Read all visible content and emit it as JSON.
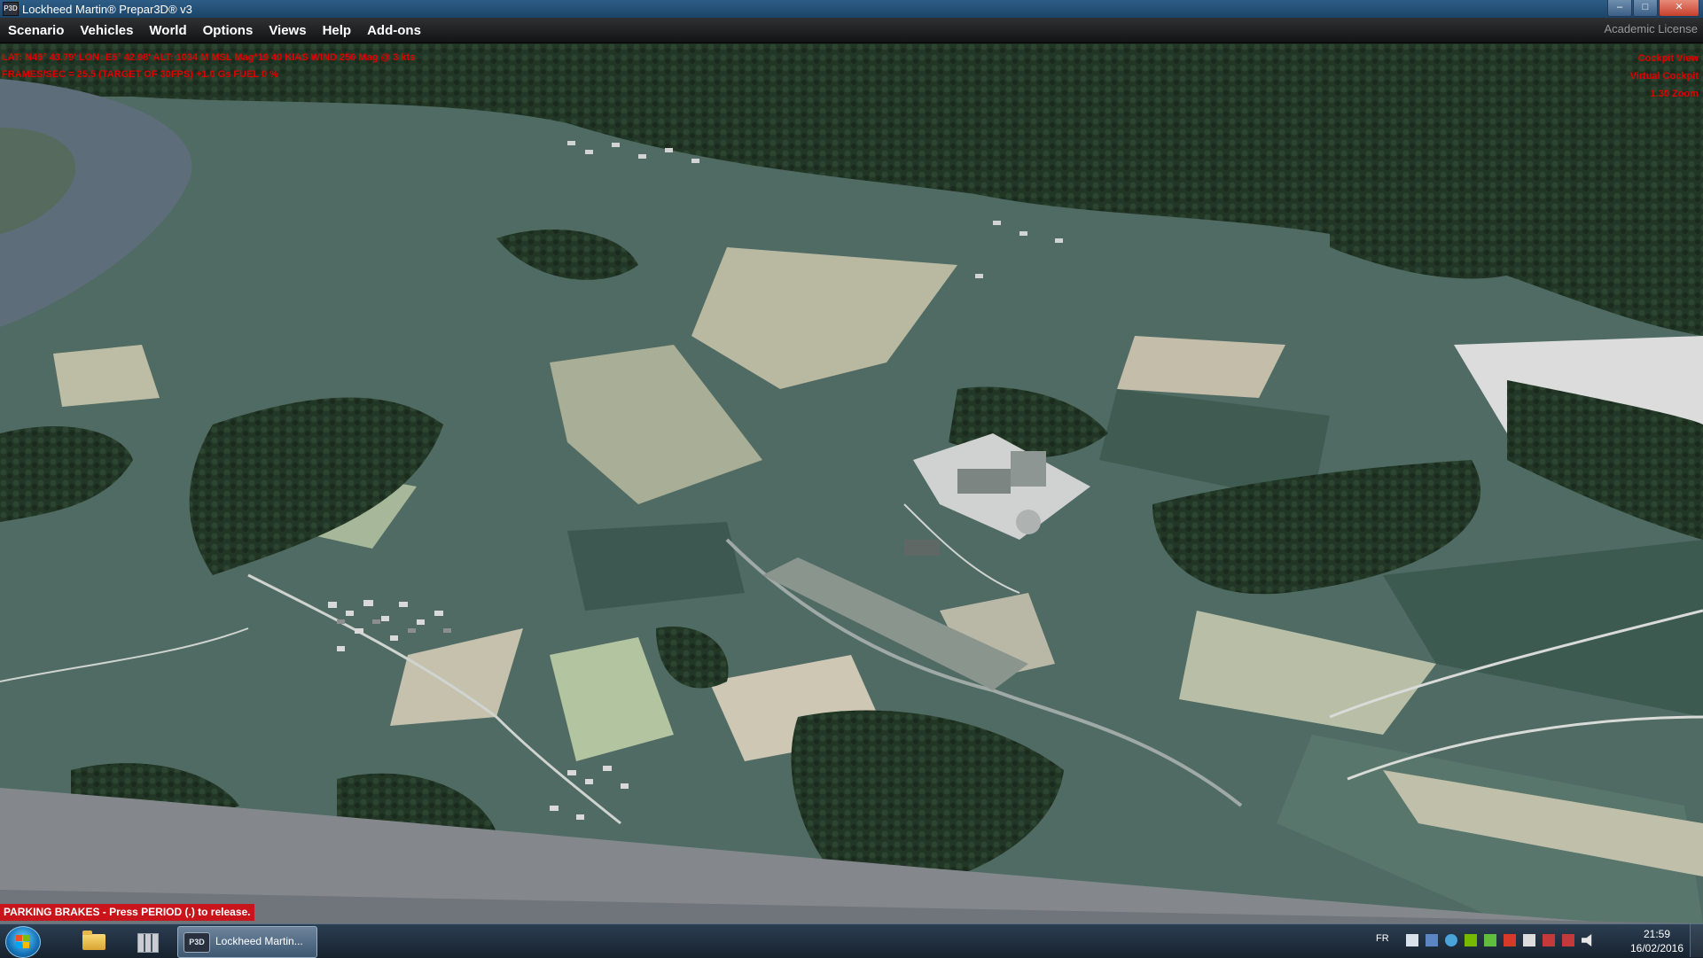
{
  "window": {
    "title": "Lockheed Martin® Prepar3D® v3",
    "icon_text": "P3D",
    "controls": [
      "minimize-icon",
      "maximize-icon",
      "close-icon"
    ]
  },
  "menu": {
    "items": [
      "Scenario",
      "Vehicles",
      "World",
      "Options",
      "Views",
      "Help",
      "Add-ons"
    ],
    "license": "Academic License"
  },
  "hud": {
    "line1": "LAT: N45° 43.79'  LON: E5° 42.98'  ALT: 1034 M  MSL  Mag*19  40 KIAS  WIND 250 Mag @ 3 kts",
    "line2": "FRAMES/SEC = 25.5   (TARGET OF 30FPS)   +1.0 Gs   FUEL 0 %",
    "right": [
      "Cockpit View",
      "Virtual Cockpit",
      "1.30 Zoom"
    ]
  },
  "status_banner": "PARKING BRAKES - Press PERIOD (.) to release.",
  "taskbar": {
    "task_label": "Lockheed Martin...",
    "task_icon": "P3D",
    "language": "FR",
    "tray_icons": [
      "action-center-icon",
      "monitor-icon",
      "network-icon",
      "nvidia-icon",
      "power-icon",
      "security-icon",
      "flag-icon",
      "usb-icon",
      "usb-icon",
      "speaker-icon"
    ],
    "time": "21:59",
    "date": "16/02/2016"
  },
  "colors": {
    "hud_text": "#e10000",
    "banner_bg": "#c8141a",
    "forest": "#1f3323",
    "field": "#4e6a62"
  }
}
